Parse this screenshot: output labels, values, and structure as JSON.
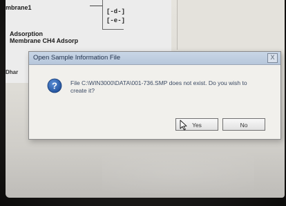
{
  "background": {
    "text_membrane": "mbrane1",
    "text_adsorption": "Adsorption",
    "text_membrane_ch4": "Membrane CH4 Adsorp",
    "text_dhar": "Dhar",
    "tree_items": [
      "[-d-]",
      "[-e-]"
    ]
  },
  "dialog": {
    "title": "Open Sample Information File",
    "close_glyph": "X",
    "message": "File C:\\WIN3000\\DATA\\001-736.SMP does not exist.  Do you wish to create it?",
    "yes_label": "Yes",
    "no_label": "No"
  },
  "colors": {
    "titlebar": "#b7c7db",
    "dialog_bg": "#f1f0ec",
    "icon_blue": "#1f4f9a"
  },
  "icons": {
    "info": "question-icon",
    "pointer": "mouse-cursor-icon"
  }
}
